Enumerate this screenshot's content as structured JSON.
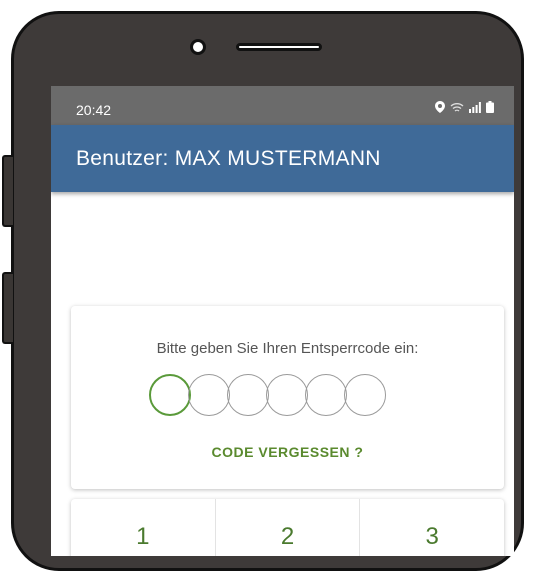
{
  "statusbar": {
    "time": "20:42",
    "icons": [
      "location-icon",
      "wifi-icon",
      "signal-icon",
      "battery-icon"
    ]
  },
  "appbar": {
    "title": "Benutzer: MAX MUSTERMANN"
  },
  "unlock": {
    "prompt": "Bitte geben Sie Ihren Entsperrcode ein:",
    "pin_length": 6,
    "digits_entered": 0,
    "forgot_label": "CODE VERGESSEN ?"
  },
  "keypad": {
    "keys": [
      "1",
      "2",
      "3"
    ]
  },
  "colors": {
    "appbar": "#3f6a98",
    "accent": "#5a8a2e",
    "statusbar": "#6b6b6b"
  }
}
